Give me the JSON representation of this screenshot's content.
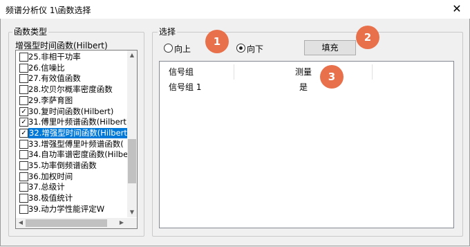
{
  "window": {
    "title": "频谱分析仪 1\\函数选择",
    "close_glyph": "✕"
  },
  "function_type": {
    "group_label": "函数类型",
    "selected_display": "增强型时间函数(Hilbert)",
    "items": [
      {
        "label": "25.非相干功率",
        "checked": false
      },
      {
        "label": "26.信噪比",
        "checked": false
      },
      {
        "label": "27.有效值函数",
        "checked": false
      },
      {
        "label": "28.坎贝尔概率密度函数",
        "checked": false
      },
      {
        "label": "29.李萨育图",
        "checked": false
      },
      {
        "label": "30.复时间函数(Hilbert)",
        "checked": true
      },
      {
        "label": "31.傅里叶频谱函数(Hilbert)",
        "checked": true
      },
      {
        "label": "32.增强型时间函数(Hilbert)",
        "checked": true,
        "selected": true
      },
      {
        "label": "33.增强型傅里叶频谱函数(",
        "checked": false
      },
      {
        "label": "34.自功率谱密度函数(Hilbe",
        "checked": false
      },
      {
        "label": "35.功率倒频谱函数",
        "checked": false
      },
      {
        "label": "36.加权时间",
        "checked": false
      },
      {
        "label": "37.总级计",
        "checked": false
      },
      {
        "label": "38.极值统计",
        "checked": false
      },
      {
        "label": "39.动力学性能评定W",
        "checked": false
      }
    ]
  },
  "selection": {
    "group_label": "选择",
    "radio_up": "向上",
    "radio_down": "向下",
    "selected_radio": "down",
    "fill_button": "填充",
    "table": {
      "headers": [
        "信号组",
        "测量"
      ],
      "rows": [
        [
          "信号组 1",
          "是"
        ]
      ]
    }
  },
  "annotations": {
    "badge1": "1",
    "badge2": "2",
    "badge3": "3"
  },
  "colors": {
    "selection_highlight": "#0078d7",
    "badge": "#e8704a"
  }
}
